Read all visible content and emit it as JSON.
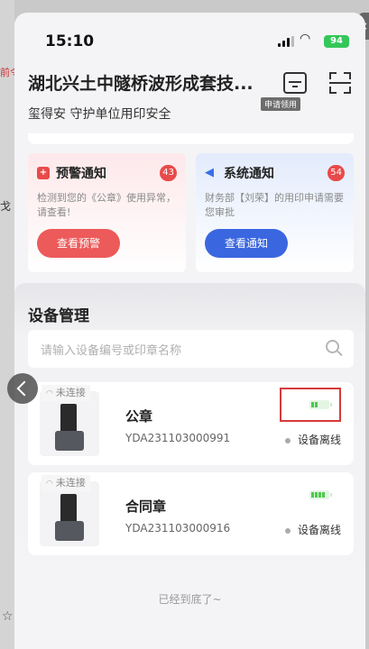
{
  "status_bar": {
    "time": "15:10",
    "battery": "94"
  },
  "header": {
    "title": "湖北兴土中隧桥波形成套技...",
    "subtitle": "玺得安 守护单位用印安全",
    "apply_label": "申请领用"
  },
  "notices": [
    {
      "title": "预警通知",
      "badge": "43",
      "desc": "检测到您的《公章》使用异常，请查看!",
      "button": "查看预警"
    },
    {
      "title": "系统通知",
      "badge": "54",
      "desc": "财务部【刘荣】的用印申请需要您审批",
      "button": "查看通知"
    }
  ],
  "devices": {
    "title": "设备管理",
    "search_placeholder": "请输入设备编号或印章名称",
    "items": [
      {
        "connection": "未连接",
        "name": "公章",
        "serial": "YDA231103000991",
        "status": "设备离线"
      },
      {
        "connection": "未连接",
        "name": "合同章",
        "serial": "YDA231103000916",
        "status": "设备离线"
      }
    ]
  },
  "footer": "已经到底了~",
  "background": {
    "left_red_text": "前令",
    "left_dark_text": "戈",
    "close_glyph": "×"
  },
  "colors": {
    "warning": "#e84a4a",
    "primary": "#3a67e0",
    "battery": "#4cc94c",
    "highlight_box": "#d63a3a"
  }
}
